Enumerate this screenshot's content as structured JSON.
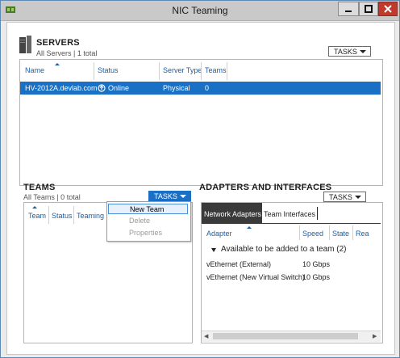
{
  "window": {
    "title": "NIC Teaming"
  },
  "servers": {
    "title": "SERVERS",
    "subtitle": "All Servers | 1 total",
    "tasks_label": "TASKS",
    "columns": [
      "Name",
      "Status",
      "Server Type",
      "Teams"
    ],
    "rows": [
      {
        "name": "HV-2012A.devlab.com",
        "status": "Online",
        "type": "Physical",
        "teams": "0",
        "selected": true
      }
    ]
  },
  "teams": {
    "title": "TEAMS",
    "subtitle": "All Teams | 0 total",
    "tasks_label": "TASKS",
    "columns": [
      "Team",
      "Status",
      "Teaming M"
    ],
    "menu": [
      "New Team",
      "Delete",
      "Properties"
    ]
  },
  "adapters": {
    "title": "ADAPTERS AND INTERFACES",
    "tasks_label": "TASKS",
    "tabs": [
      "Network Adapters",
      "Team Interfaces"
    ],
    "columns": [
      "Adapter",
      "Speed",
      "State",
      "Rea"
    ],
    "group": "Available to be added to a team (2)",
    "rows": [
      {
        "adapter": "vEthernet (External)",
        "speed": "10 Gbps"
      },
      {
        "adapter": "vEthernet (New Virtual Switch)",
        "speed": "10 Gbps"
      }
    ]
  },
  "colors": {
    "selection": "#1a70c5",
    "header_text": "#1a5fa8",
    "dark_tab": "#3a3a3a"
  }
}
